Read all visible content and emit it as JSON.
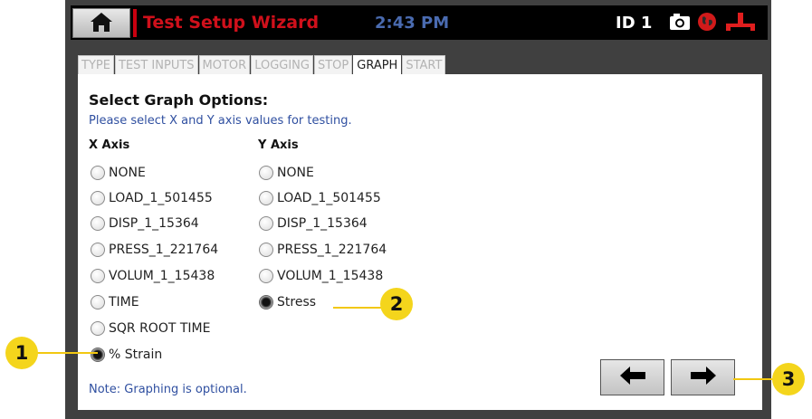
{
  "header": {
    "title": "Test Setup Wizard",
    "time": "2:43 PM",
    "id_label": "ID 1",
    "icons": [
      "home-icon",
      "camera-icon",
      "globe-icon",
      "network-icon"
    ]
  },
  "tabs": [
    {
      "label": "TYPE",
      "active": false
    },
    {
      "label": "TEST INPUTS",
      "active": false
    },
    {
      "label": "MOTOR",
      "active": false
    },
    {
      "label": "LOGGING",
      "active": false
    },
    {
      "label": "STOP",
      "active": false
    },
    {
      "label": "GRAPH",
      "active": true
    },
    {
      "label": "START",
      "active": false
    }
  ],
  "main": {
    "heading": "Select Graph Options:",
    "instructions": "Please select X and Y axis values for testing.",
    "x_axis": {
      "label": "X Axis",
      "options": [
        "NONE",
        "LOAD_1_501455",
        "DISP_1_15364",
        "PRESS_1_221764",
        "VOLUM_1_15438",
        "TIME",
        "SQR ROOT TIME",
        "% Strain"
      ],
      "selected": "% Strain"
    },
    "y_axis": {
      "label": "Y Axis",
      "options": [
        "NONE",
        "LOAD_1_501455",
        "DISP_1_15364",
        "PRESS_1_221764",
        "VOLUM_1_15438",
        "Stress"
      ],
      "selected": "Stress"
    },
    "note": "Note: Graphing is optional."
  },
  "navigation": {
    "back_icon": "arrow-left-icon",
    "next_icon": "arrow-right-icon"
  },
  "callouts": [
    "1",
    "2",
    "3"
  ],
  "colors": {
    "title_red": "#d0101b",
    "clock_blue": "#4a6bb0",
    "note_blue": "#2f4fa0",
    "callout_yellow": "#f4d51c"
  }
}
